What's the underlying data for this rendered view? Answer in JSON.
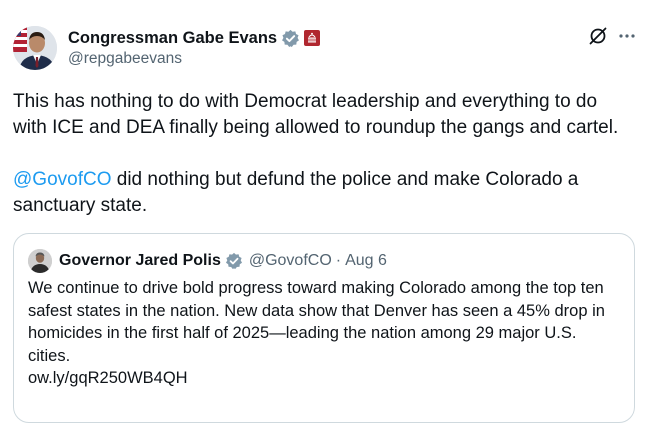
{
  "author": {
    "display_name": "Congressman Gabe Evans",
    "handle": "@repgabeevans",
    "verified_icon": "verified-badge-icon",
    "affiliation_icon": "us-congress-affiliation-icon"
  },
  "header_actions": {
    "grok_icon": "grok-icon",
    "more_icon": "more-options-icon"
  },
  "tweet": {
    "paragraph1": "This has nothing to do with Democrat leadership and everything to do with ICE and DEA finally being allowed to roundup the gangs and cartel.",
    "mention": "@GovofCO",
    "paragraph2_rest": " did nothing but defund the police and make Colorado a sanctuary state."
  },
  "quoted_tweet": {
    "display_name": "Governor Jared Polis",
    "handle": "@GovofCO",
    "separator": "·",
    "date": "Aug 6",
    "lines": [
      "We continue to drive bold progress toward making Colorado among the top ten",
      "safest states in the nation. New data show that Denver has seen a 45% drop in",
      "homicides in the first half of 2025—leading the nation among 29 major U.S.",
      "cities.",
      "ow.ly/gqR250WB4QH"
    ]
  },
  "colors": {
    "text": "#0f1419",
    "secondary": "#536471",
    "link": "#1d9bf0",
    "verified": "#829aab",
    "border": "#cfd9de"
  }
}
